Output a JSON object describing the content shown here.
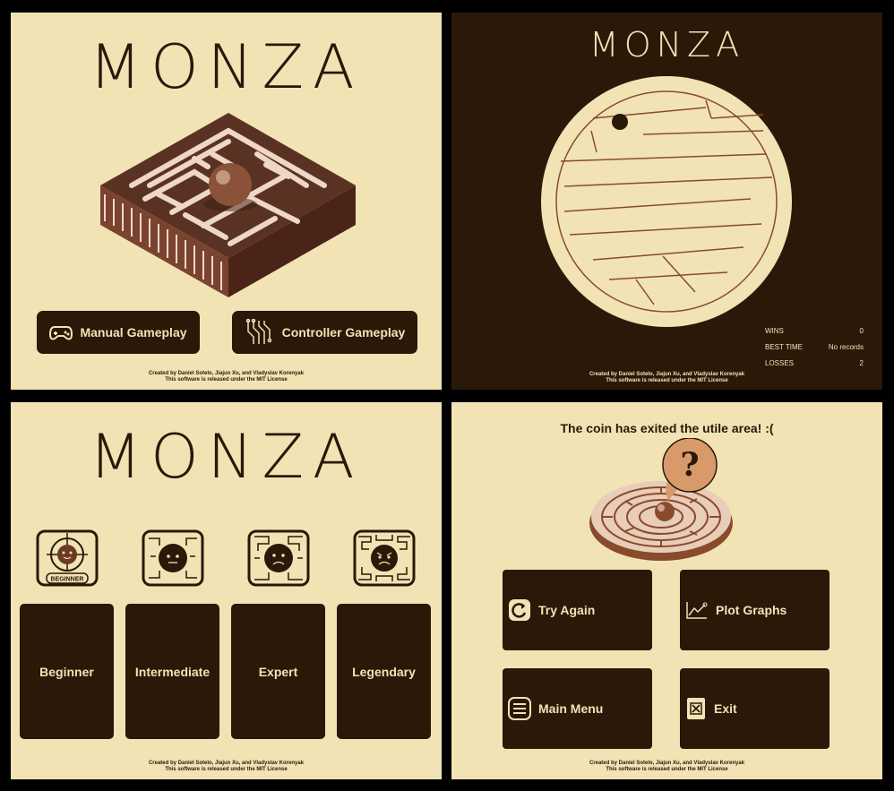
{
  "app": {
    "title": "MONZA"
  },
  "credits": {
    "line1": "Created by Daniel Sotelo, Jiajun Xu, and Vladyslav Korenyak",
    "line2": "This software is released under the MIT License"
  },
  "main_menu": {
    "buttons": {
      "manual": {
        "label": "Manual Gameplay",
        "icon": "gamepad-icon"
      },
      "controller": {
        "label": "Controller Gameplay",
        "icon": "circuit-icon"
      }
    }
  },
  "gameplay": {
    "stats": [
      {
        "label": "WINS",
        "value": "0"
      },
      {
        "label": "BEST TIME",
        "value": "No records"
      },
      {
        "label": "LOSSES",
        "value": "2"
      }
    ]
  },
  "difficulty": {
    "badge_label": "BEGINNER",
    "levels": [
      {
        "label": "Beginner"
      },
      {
        "label": "Intermediate"
      },
      {
        "label": "Expert"
      },
      {
        "label": "Legendary"
      }
    ]
  },
  "game_over": {
    "message": "The coin has exited the utile area! :(",
    "question_mark": "?",
    "buttons": {
      "try_again": {
        "label": "Try Again",
        "icon": "refresh-icon"
      },
      "plot_graphs": {
        "label": "Plot Graphs",
        "icon": "line-chart-icon"
      },
      "main_menu": {
        "label": "Main Menu",
        "icon": "menu-icon"
      },
      "exit": {
        "label": "Exit",
        "icon": "close-icon"
      }
    }
  },
  "colors": {
    "background": "#f2e3b4",
    "dark": "#2a1809",
    "maze": "#8a4a2c"
  }
}
